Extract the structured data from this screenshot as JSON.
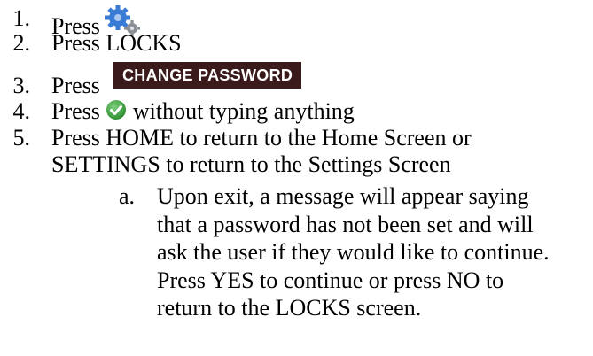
{
  "steps": [
    {
      "num": "1.",
      "text": "Press",
      "icon": "gears-icon"
    },
    {
      "num": "2.",
      "text": "Press LOCKS"
    },
    {
      "num": "3.",
      "text": "Press",
      "button_label": "CHANGE PASSWORD"
    },
    {
      "num": "4.",
      "text_before": "Press",
      "icon": "checkmark-icon",
      "text_after": "without typing anything"
    },
    {
      "num": "5.",
      "lines": [
        "Press HOME to return to the Home Screen or",
        "SETTINGS to return to the Settings Screen"
      ]
    }
  ],
  "substep": {
    "letter": "a.",
    "lines": [
      "Upon exit, a message will appear saying",
      "that a password has not been set and will",
      "ask the user if they would like to continue.",
      "Press YES to continue or press NO to",
      "return to the LOCKS screen."
    ]
  },
  "colors": {
    "button_bg": "#3a1a1a",
    "check_green": "#3aa33a",
    "gear_blue": "#3a7bd5"
  }
}
